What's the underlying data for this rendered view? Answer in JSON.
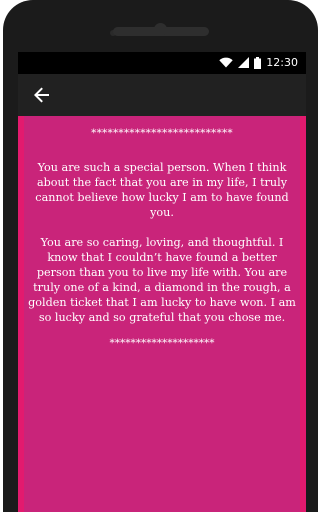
{
  "status_bar": {
    "time": "12:30",
    "icons": [
      "wifi-icon",
      "cell-signal-icon",
      "battery-icon"
    ]
  },
  "app_bar": {
    "back_icon": "arrow-back-icon"
  },
  "message": {
    "top_divider": "**************************",
    "paragraph_1": "You are such a special person. When I think about the fact that you are in my life, I truly cannot believe how lucky I am to have found you.",
    "paragraph_2": "You are so caring, loving, and thoughtful. I know that I couldn’t have found a better person than you to live my life with. You are truly one of a kind, a diamond in the rough, a golden ticket that I am lucky to have won. I am so lucky and so grateful that you chose me.",
    "bottom_divider": "********************"
  },
  "colors": {
    "screen_bg": "#e31a6e",
    "card_bg": "#c9247a",
    "app_bar_bg": "#212121",
    "status_bar_bg": "#000000"
  }
}
